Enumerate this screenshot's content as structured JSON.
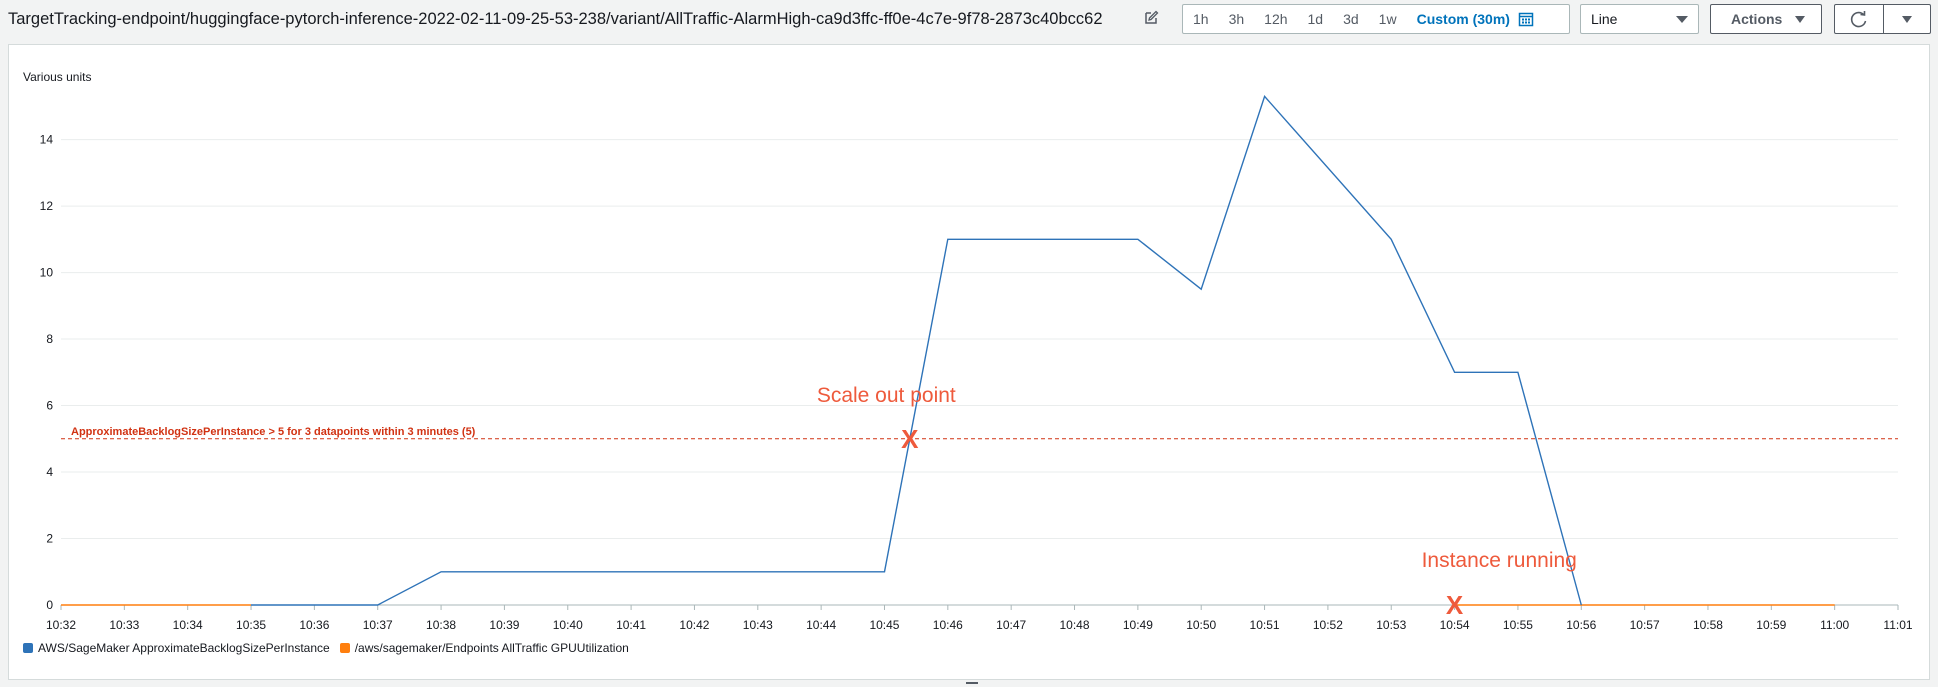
{
  "header": {
    "title": "TargetTracking-endpoint/huggingface-pytorch-inference-2022-02-11-09-25-53-238/variant/AllTraffic-AlarmHigh-ca9d3ffc-ff0e-4c7e-9f78-2873c40bcc62",
    "ranges": [
      "1h",
      "3h",
      "12h",
      "1d",
      "3d",
      "1w"
    ],
    "custom_range": "Custom (30m)",
    "view_select": "Line",
    "actions_label": "Actions"
  },
  "units_label": "Various units",
  "colors": {
    "series1": "#2e73b8",
    "series2": "#ff7f0e",
    "threshold": "#d13212",
    "annotation": "#ee5a3c",
    "grid": "#eaeded"
  },
  "legend": [
    {
      "label": "AWS/SageMaker ApproximateBacklogSizePerInstance",
      "color": "#2e73b8"
    },
    {
      "label": "/aws/sagemaker/Endpoints AllTraffic GPUUtilization",
      "color": "#ff7f0e"
    }
  ],
  "chart_data": {
    "type": "line",
    "x": [
      "10:32",
      "10:33",
      "10:34",
      "10:35",
      "10:36",
      "10:37",
      "10:38",
      "10:39",
      "10:40",
      "10:41",
      "10:42",
      "10:43",
      "10:44",
      "10:45",
      "10:46",
      "10:47",
      "10:48",
      "10:49",
      "10:50",
      "10:51",
      "10:52",
      "10:53",
      "10:54",
      "10:55",
      "10:56",
      "10:57",
      "10:58",
      "10:59",
      "11:00",
      "11:01"
    ],
    "ylim": [
      0,
      16
    ],
    "yticks": [
      0,
      2,
      4,
      6,
      8,
      10,
      12,
      14
    ],
    "series": [
      {
        "name": "AWS/SageMaker ApproximateBacklogSizePerInstance",
        "color": "#2e73b8",
        "points": [
          [
            "10:35",
            0
          ],
          [
            "10:37",
            0
          ],
          [
            "10:38",
            1
          ],
          [
            "10:45",
            1
          ],
          [
            "10:46",
            11
          ],
          [
            "10:49",
            11
          ],
          [
            "10:50",
            9.5
          ],
          [
            "10:51",
            15.3
          ],
          [
            "10:53",
            11
          ],
          [
            "10:54",
            7
          ],
          [
            "10:55",
            7
          ],
          [
            "10:56",
            0
          ]
        ]
      },
      {
        "name": "/aws/sagemaker/Endpoints AllTraffic GPUUtilization",
        "color": "#ff7f0e",
        "segments": [
          [
            [
              "10:32",
              0
            ],
            [
              "10:35",
              0
            ]
          ],
          [
            [
              "10:54",
              0
            ],
            [
              "11:00",
              0
            ]
          ]
        ]
      }
    ],
    "threshold": {
      "value": 5,
      "label": "ApproximateBacklogSizePerInstance > 5 for 3 datapoints within 3 minutes (5)"
    },
    "annotations": [
      {
        "text": "Scale out point",
        "marker": "X",
        "x": "10:45.4",
        "y": 5
      },
      {
        "text": "Instance running",
        "marker": "X",
        "x": "10:54",
        "y": 0
      }
    ],
    "grid": true,
    "legend_position": "bottom-left"
  }
}
